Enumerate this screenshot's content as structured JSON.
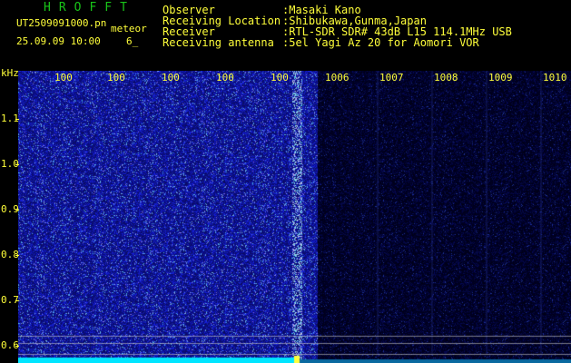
{
  "header": {
    "app_title": "HROFFT",
    "filename": "UT2509091000.pn",
    "event_type": "meteor",
    "datetime": "25.09.09 10:00",
    "event_count": "6_",
    "info_labels": [
      "Observer",
      "Receiving Location",
      "Receiver",
      "Receiving antenna"
    ],
    "info_values": [
      ":Masaki Kano",
      ":Shibukawa,Gunma,Japan",
      ":RTL-SDR SDR# 43dB L15 114.1MHz USB",
      ":5el Yagi Az 20 for Aomori VOR"
    ]
  },
  "axes": {
    "y_unit": "kHz",
    "y_ticks": [
      "1.1",
      "1.0",
      "0.9",
      "0.8",
      "0.7",
      "0.6"
    ],
    "x_ticks": [
      "100",
      "100",
      "100",
      "100",
      "100",
      "1006",
      "1007",
      "1008",
      "1009",
      "1010"
    ]
  },
  "colors": {
    "background": "#000000",
    "text": "#ffff3a",
    "title": "#19c419",
    "noise": "#1820a0",
    "floor": "#00e5ff"
  }
}
